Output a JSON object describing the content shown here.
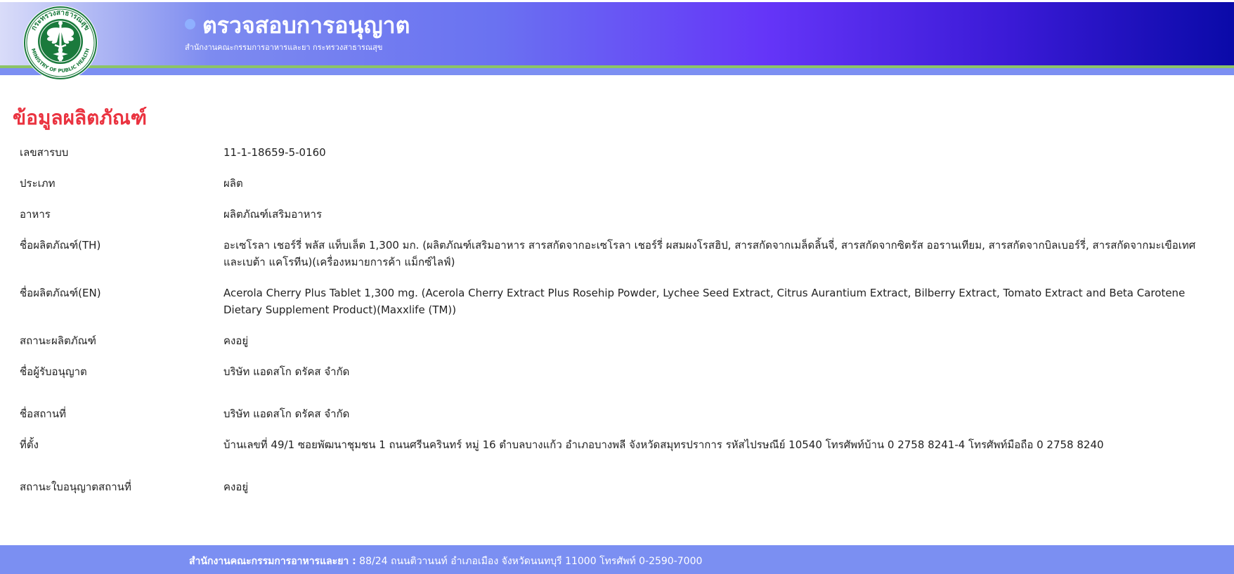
{
  "header": {
    "title": "ตรวจสอบการอนุญาต",
    "subtitle": "สำนักงานคณะกรรมการอาหารและยา กระทรวงสาธารณสุข",
    "logo": {
      "icon": "moph-seal-icon",
      "text_top": "กระทรวงสาธารณสุข",
      "text_bottom": "MINISTRY OF PUBLIC HEALTH",
      "color": "#1a7a3c"
    }
  },
  "page": {
    "title": "ข้อมูลผลิตภัณฑ์",
    "title_color": "#ea3340"
  },
  "fields": [
    {
      "label": "เลขสารบบ",
      "value": "11-1-18659-5-0160"
    },
    {
      "label": "ประเภท",
      "value": "ผลิต"
    },
    {
      "label": "อาหาร",
      "value": "ผลิตภัณฑ์เสริมอาหาร"
    },
    {
      "label": "ชื่อผลิตภัณฑ์(TH)",
      "value": "อะเซโรลา เชอร์รี่ พลัส แท็บเล็ต 1,300 มก. (ผลิตภัณฑ์เสริมอาหาร สารสกัดจากอะเซโรลา เชอร์รี่ ผสมผงโรสฮิป, สารสกัดจากเมล็ดลิ้นจี่, สารสกัดจากซิตรัส ออรานเทียม, สารสกัดจากบิลเบอร์รี่, สารสกัดจากมะเขือเทศ และเบต้า แคโรทีน)(เครื่องหมายการค้า แม็กซ์ไลฟ์)"
    },
    {
      "label": "ชื่อผลิตภัณฑ์(EN)",
      "value": "Acerola Cherry Plus Tablet 1,300 mg. (Acerola Cherry Extract Plus Rosehip Powder, Lychee Seed Extract, Citrus Aurantium Extract, Bilberry Extract, Tomato Extract and Beta Carotene Dietary Supplement Product)(Maxxlife (TM))"
    },
    {
      "label": "สถานะผลิตภัณฑ์",
      "value": "คงอยู่"
    },
    {
      "label": "ชื่อผู้รับอนุญาต",
      "value": "บริษัท แอดสโก ดรัคส จำกัด"
    },
    {
      "label": "ชื่อสถานที่",
      "value": "บริษัท แอดสโก ดรัคส จำกัด"
    },
    {
      "label": "ที่ตั้ง",
      "value": "บ้านเลขที่ 49/1 ซอยพัฒนาชุมชน 1 ถนนศรีนครินทร์ หมู่ 16 ตำบลบางแก้ว อำเภอบางพลี จังหวัดสมุทรปราการ รหัสไปรษณีย์ 10540 โทรศัพท์บ้าน 0 2758 8241-4 โทรศัพท์มือถือ 0 2758 8240"
    },
    {
      "label": "สถานะใบอนุญาตสถานที่",
      "value": "คงอยู่"
    }
  ],
  "footer": {
    "org": "สำนักงานคณะกรรมการอาหารและยา :",
    "address": " 88/24 ถนนติวานนท์ อำเภอเมือง จังหวัดนนทบุรี 11000 โทรศัพท์ 0-2590-7000"
  }
}
